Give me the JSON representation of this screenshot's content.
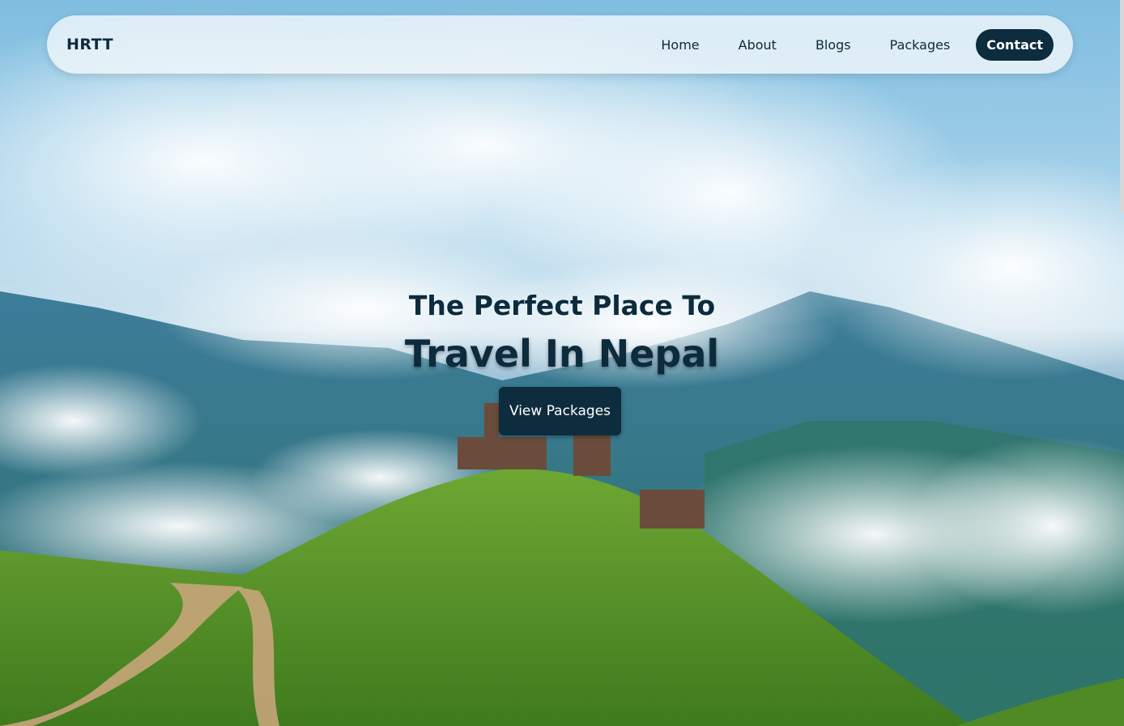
{
  "brand": "HRTT",
  "nav": {
    "items": [
      {
        "label": "Home"
      },
      {
        "label": "About"
      },
      {
        "label": "Blogs"
      },
      {
        "label": "Packages"
      }
    ],
    "contact_label": "Contact"
  },
  "hero": {
    "subtitle": "The Perfect Place To",
    "title": "Travel In Nepal",
    "cta_label": "View Packages"
  },
  "colors": {
    "primary": "#0d2c3d",
    "navbar_bg": "#f0f6fa",
    "grass": "#5f9a2a",
    "sky": "#8ec7e6"
  }
}
